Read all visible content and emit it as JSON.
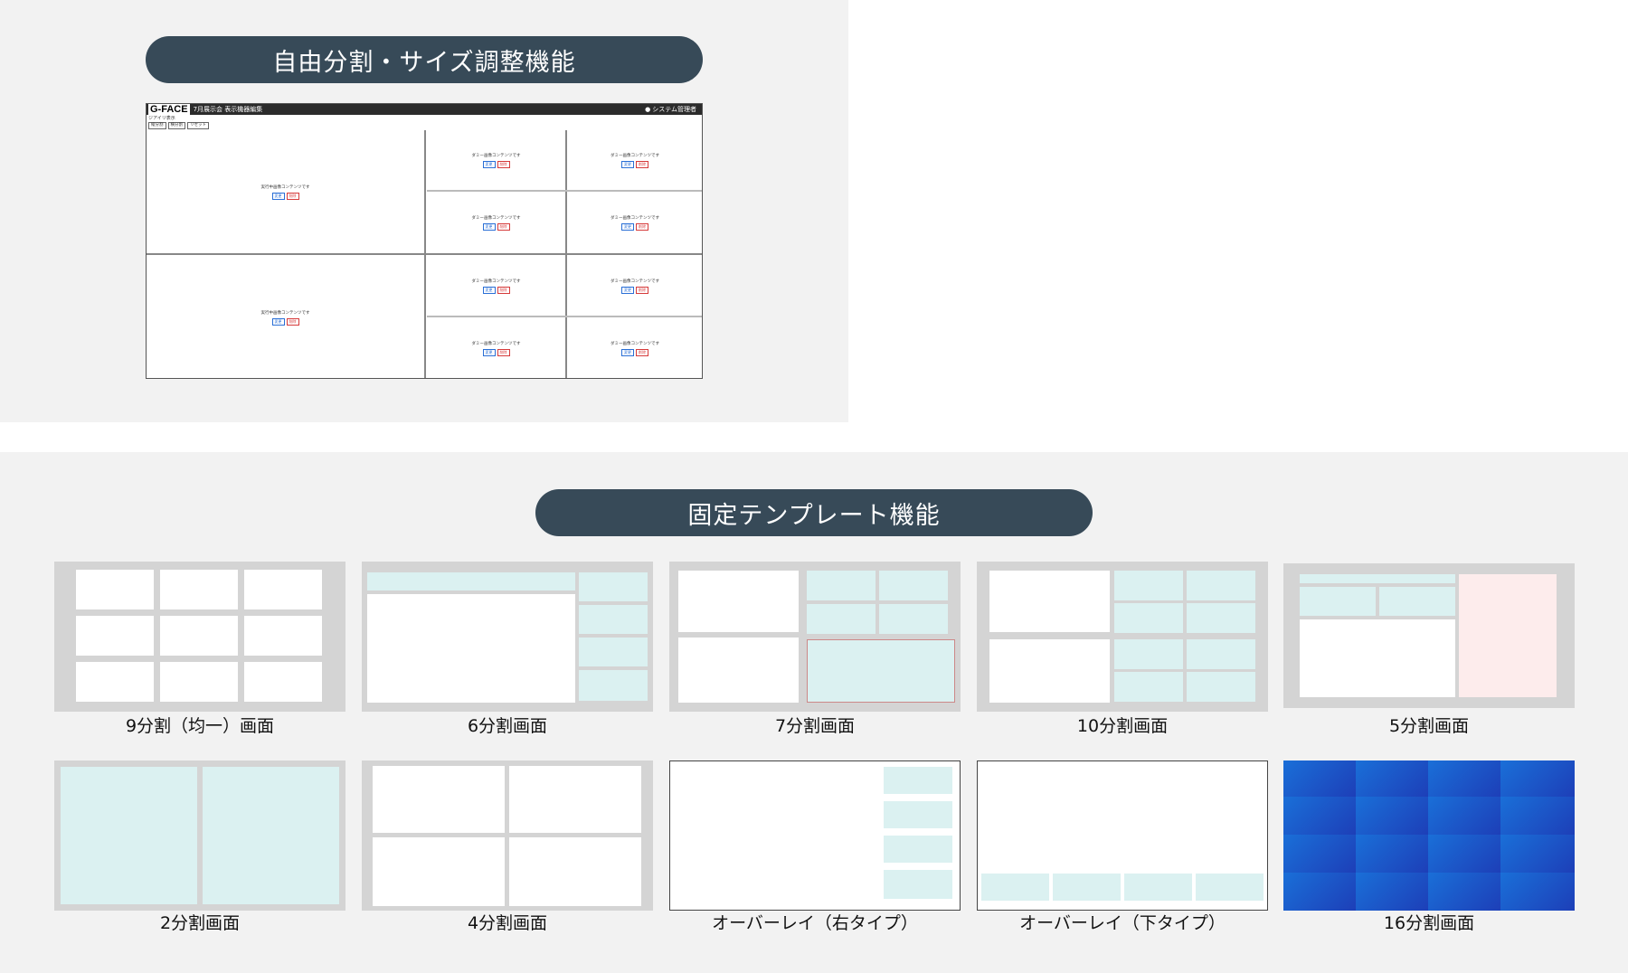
{
  "section_free": {
    "title": "自由分割・サイズ調整機能",
    "app": {
      "logo": "G-FACE",
      "title": "7月展示会 表示機器編集",
      "user": "システム管理者",
      "user_icon": "person-icon",
      "subtitle": "ジアイリ表示",
      "tools": [
        "縦分割",
        "横分割",
        "リセット"
      ],
      "cells": [
        {
          "label": "実行中画像コンテンツです",
          "edit": "変更",
          "delete": "削除"
        },
        {
          "label": "ダミー画像コンテンツです",
          "edit": "変更",
          "delete": "削除"
        },
        {
          "label": "ダミー画像コンテンツです",
          "edit": "変更",
          "delete": "削除"
        },
        {
          "label": "ダミー画像コンテンツです",
          "edit": "変更",
          "delete": "削除"
        },
        {
          "label": "ダミー画像コンテンツです",
          "edit": "変更",
          "delete": "削除"
        },
        {
          "label": "実行中画像コンテンツです",
          "edit": "変更",
          "delete": "削除"
        },
        {
          "label": "ダミー画像コンテンツです",
          "edit": "変更",
          "delete": "削除"
        },
        {
          "label": "ダミー画像コンテンツです",
          "edit": "変更",
          "delete": "削除"
        },
        {
          "label": "ダミー画像コンテンツです",
          "edit": "変更",
          "delete": "削除"
        },
        {
          "label": "ダミー画像コンテンツです",
          "edit": "変更",
          "delete": "削除"
        }
      ]
    }
  },
  "section_fixed": {
    "title": "固定テンプレート機能",
    "templates": [
      {
        "caption": "9分割（均一）画面"
      },
      {
        "caption": "6分割画面"
      },
      {
        "caption": "7分割画面"
      },
      {
        "caption": "10分割画面"
      },
      {
        "caption": "5分割画面"
      },
      {
        "caption": "2分割画面"
      },
      {
        "caption": "4分割画面"
      },
      {
        "caption": "オーバーレイ（右タイプ）"
      },
      {
        "caption": "オーバーレイ（下タイプ）"
      },
      {
        "caption": "16分割画面"
      }
    ]
  },
  "colors": {
    "pill": "#374a58",
    "panel_bg": "#f2f2f2",
    "cyan_cell": "#dbf1f1",
    "pink_cell": "#fdecec",
    "blue_grid": "#1c4fc4"
  }
}
